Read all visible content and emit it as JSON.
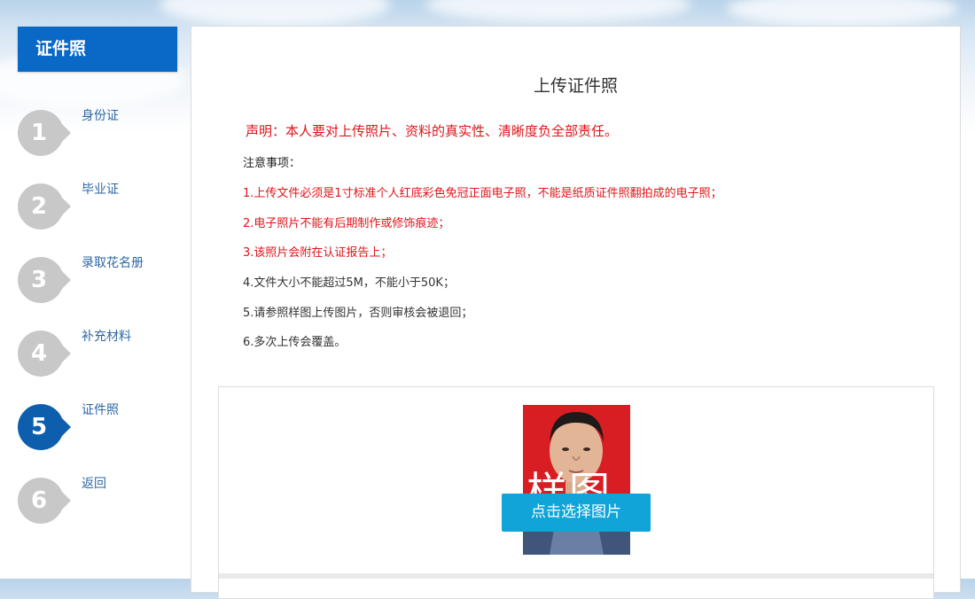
{
  "sidebar": {
    "title": "证件照",
    "steps": [
      {
        "num": "1",
        "label": "身份证",
        "active": false
      },
      {
        "num": "2",
        "label": "毕业证",
        "active": false
      },
      {
        "num": "3",
        "label": "录取花名册",
        "active": false
      },
      {
        "num": "4",
        "label": "补充材料",
        "active": false
      },
      {
        "num": "5",
        "label": "证件照",
        "active": true
      },
      {
        "num": "6",
        "label": "返回",
        "active": false
      }
    ]
  },
  "main": {
    "title": "上传证件照",
    "declaration": "声明：本人要对上传照片、资料的真实性、清晰度负全部责任。",
    "notes_heading": "注意事项：",
    "notes": [
      "1.上传文件必须是1寸标准个人红底彩色免冠正面电子照，不能是纸质证件照翻拍成的电子照；",
      "2.电子照片不能有后期制作或修饰痕迹；",
      "3.该照片会附在认证报告上；",
      "4.文件大小不能超过5M，不能小于50K；",
      "5.请参照样图上传图片，否则审核会被退回；",
      "6.多次上传会覆盖。"
    ],
    "sample_watermark": "样图",
    "choose_button": "点击选择图片"
  },
  "colors": {
    "accent": "#0a68c6",
    "active_badge": "#0d5fae",
    "inactive_badge": "#c8c8c8",
    "warning_red": "#e0141a",
    "button": "#10a4d8"
  }
}
